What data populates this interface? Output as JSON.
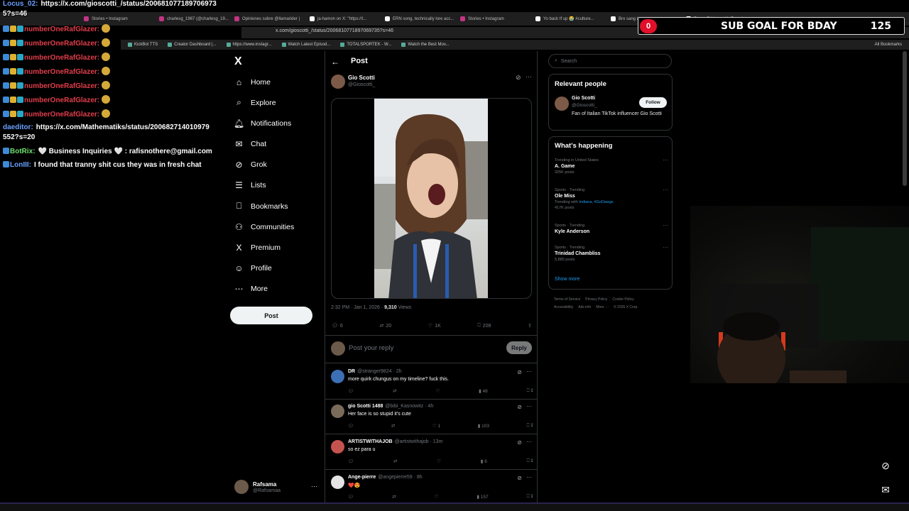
{
  "browser": {
    "tabs": [
      {
        "label": "Stories • Instagram",
        "icon": "instagram-icon"
      },
      {
        "label": "charlesg_1967 (@charlesg_19...",
        "icon": "instagram-icon"
      },
      {
        "label": "Opiniones sobre @llamarider |",
        "icon": "instagram-icon"
      },
      {
        "label": "ja-hamon on X: \"https://t...",
        "icon": "x-icon"
      },
      {
        "label": "ERN song, technically lore acc...",
        "icon": "x-icon"
      },
      {
        "label": "Stories • Instagram",
        "icon": "instagram-icon"
      },
      {
        "label": "Yo back tf up 😭 #culture...",
        "icon": "x-icon"
      },
      {
        "label": "Bro sang the gum song",
        "icon": "x-icon"
      },
      {
        "label": "Funny Fridays with Female...",
        "icon": "x-icon"
      }
    ],
    "url": "x.com/gioscotti_/status/2006810771897069735?s=46",
    "bookmarks": [
      "KickBot TTS",
      "Creator Dashboard |...",
      "https://www.instagr...",
      "Watch Latest Episod...",
      "TOTALSPORTEK - W...",
      "Watch the Best Mov..."
    ],
    "all_bookmarks": "All Bookmarks"
  },
  "subgoal": {
    "badge": "0",
    "title": "SUB GOAL FOR BDAY",
    "count": "125"
  },
  "chat": {
    "lines": [
      {
        "name": "Locus_02:",
        "msg": "https://x.com/gioscotti_/status/200681077189706973"
      },
      {
        "name": "",
        "msg": "5?s=46"
      },
      {
        "name": "numberOneRafGlazer:",
        "msg": ""
      },
      {
        "name": "numberOneRafGlazer:",
        "msg": ""
      },
      {
        "name": "numberOneRafGlazer:",
        "msg": ""
      },
      {
        "name": "numberOneRafGlazer:",
        "msg": ""
      },
      {
        "name": "numberOneRafGlazer:",
        "msg": ""
      },
      {
        "name": "numberOneRafGlazer:",
        "msg": ""
      },
      {
        "name": "numberOneRafGlazer:",
        "msg": ""
      },
      {
        "name": "daeditor:",
        "msg": "https://x.com/Mathematiks/status/200682714010979"
      },
      {
        "name": "",
        "msg": "552?s=20"
      },
      {
        "name": "BotRix:",
        "msg": "🤍 Business Inquiries 🤍 : rafisnothere@gmail.com"
      },
      {
        "name": "LonIII:",
        "msg": "I found that tranny shit cus they was in fresh chat"
      }
    ]
  },
  "nav": {
    "logo": "X",
    "items": [
      {
        "label": "Home",
        "icon": "home-icon"
      },
      {
        "label": "Explore",
        "icon": "search-icon"
      },
      {
        "label": "Notifications",
        "icon": "bell-icon"
      },
      {
        "label": "Chat",
        "icon": "mail-icon"
      },
      {
        "label": "Grok",
        "icon": "grok-icon"
      },
      {
        "label": "Lists",
        "icon": "list-icon"
      },
      {
        "label": "Bookmarks",
        "icon": "bookmark-icon"
      },
      {
        "label": "Communities",
        "icon": "communities-icon"
      },
      {
        "label": "Premium",
        "icon": "x-premium-icon"
      },
      {
        "label": "Profile",
        "icon": "profile-icon"
      },
      {
        "label": "More",
        "icon": "more-circle-icon"
      }
    ],
    "post_button": "Post",
    "account": {
      "name": "Rafsama",
      "handle": "@Rafsamaa"
    }
  },
  "post": {
    "header": "Post",
    "author": {
      "name": "Gio Scotti",
      "handle": "@Gioscotti_"
    },
    "meta": {
      "time": "2:32 PM · Jan 1, 2026 · ",
      "views": "9,310",
      "views_label": " Views"
    },
    "actions": {
      "replies": "6",
      "reposts": "20",
      "likes": "1K",
      "bookmarks": "208"
    },
    "reply_placeholder": "Post your reply",
    "reply_button": "Reply"
  },
  "replies": [
    {
      "name": "DR",
      "handle": "@stranger9824 · 2h",
      "text": "more quirk chungus on my timeline? fuck this.",
      "views": "48",
      "likes": ""
    },
    {
      "name": "gio Scotti 1488",
      "handle": "@bibi_Kasnowitz · 4h",
      "text": "Her face is so stupid it's cute",
      "views": "103",
      "likes": "1"
    },
    {
      "name": "ARTISTWITHAJOB",
      "handle": "@artistwithajob · 13m",
      "text": "so ez para u",
      "views": "6",
      "likes": ""
    },
    {
      "name": "Ange-pierre",
      "handle": "@angepierre59 · 8h",
      "text": "❤️😍",
      "views": "157",
      "likes": ""
    }
  ],
  "sidebar": {
    "search_placeholder": "Search",
    "relevant": {
      "title": "Relevant people",
      "name": "Gio Scotti",
      "handle": "@Gioscotti_",
      "follow": "Follow",
      "bio": "Fan of Italian TikTok influencer Gio Scotti"
    },
    "happening": {
      "title": "What's happening",
      "trends": [
        {
          "context": "Trending in United States",
          "title": "A. Game",
          "with": "",
          "posts": "325K posts"
        },
        {
          "context": "Sports · Trending",
          "title": "Ole Miss",
          "with": "Indiana, #GoDawgs",
          "posts": "417K posts"
        },
        {
          "context": "Sports · Trending",
          "title": "Kyle Anderson",
          "with": "",
          "posts": ""
        },
        {
          "context": "Sports · Trending",
          "title": "Trinidad Chambliss",
          "with": "",
          "posts": "5,885 posts"
        }
      ],
      "show_more": "Show more"
    },
    "footer": [
      "Terms of Service",
      "Privacy Policy",
      "Cookie Policy",
      "Accessibility",
      "Ads info",
      "More ···",
      "© 2026 X Corp."
    ]
  },
  "colors": {
    "accent": "#1d9bf0",
    "chat_name": "#e23d4a",
    "goal_badge": "#e0102a"
  }
}
